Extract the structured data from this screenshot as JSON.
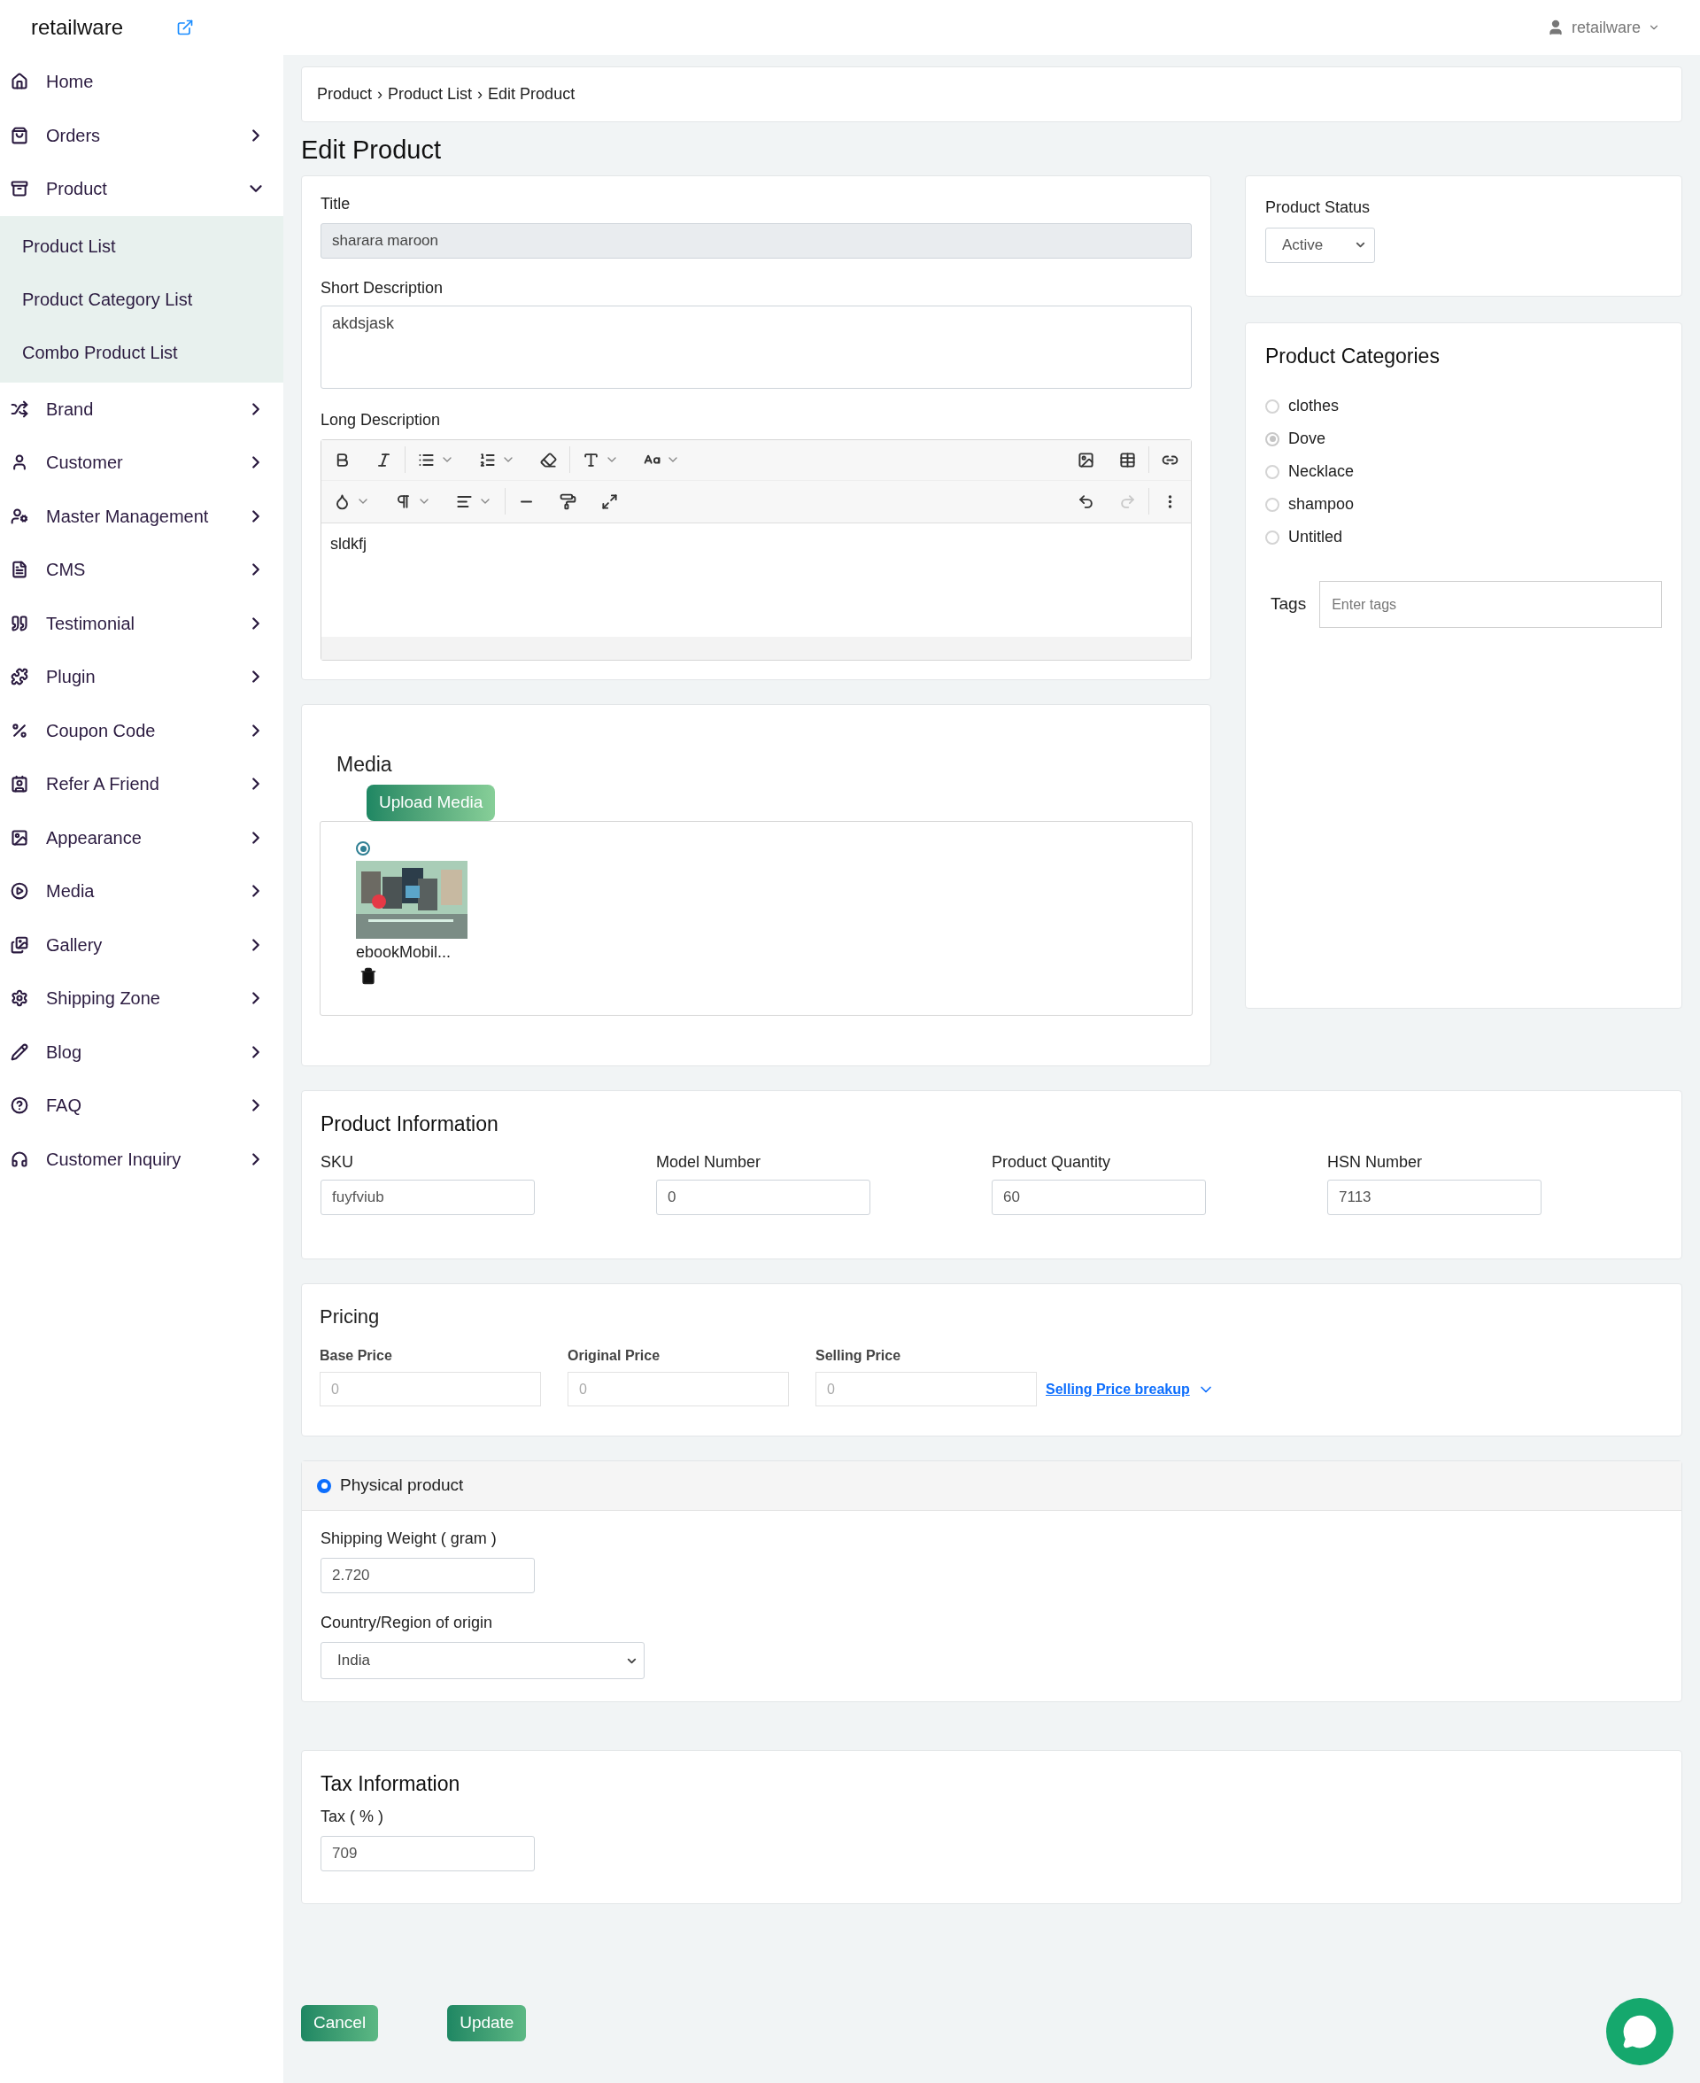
{
  "brand": {
    "name": "retailware"
  },
  "user_menu": {
    "label": "retailware"
  },
  "sidebar": {
    "items": [
      {
        "label": "Home",
        "kind": "link"
      },
      {
        "label": "Orders",
        "kind": "group",
        "expanded": false
      },
      {
        "label": "Product",
        "kind": "group",
        "expanded": true,
        "children": [
          {
            "label": "Product List"
          },
          {
            "label": "Product Category List"
          },
          {
            "label": "Combo Product List"
          }
        ]
      },
      {
        "label": "Brand",
        "kind": "group",
        "expanded": false
      },
      {
        "label": "Customer",
        "kind": "group",
        "expanded": false
      },
      {
        "label": "Master Management",
        "kind": "group",
        "expanded": false
      },
      {
        "label": "CMS",
        "kind": "group",
        "expanded": false
      },
      {
        "label": "Testimonial",
        "kind": "group",
        "expanded": false
      },
      {
        "label": "Plugin",
        "kind": "group",
        "expanded": false
      },
      {
        "label": "Coupon Code",
        "kind": "group",
        "expanded": false
      },
      {
        "label": "Refer A Friend",
        "kind": "group",
        "expanded": false
      },
      {
        "label": "Appearance",
        "kind": "group",
        "expanded": false
      },
      {
        "label": "Media",
        "kind": "group",
        "expanded": false
      },
      {
        "label": "Gallery",
        "kind": "group",
        "expanded": false
      },
      {
        "label": "Shipping Zone",
        "kind": "group",
        "expanded": false
      },
      {
        "label": "Blog",
        "kind": "group",
        "expanded": false
      },
      {
        "label": "FAQ",
        "kind": "group",
        "expanded": false
      },
      {
        "label": "Customer Inquiry",
        "kind": "group",
        "expanded": false
      }
    ]
  },
  "breadcrumb": [
    "Product",
    "Product List",
    "Edit Product"
  ],
  "breadcrumb_separator": "›",
  "page_title": "Edit Product",
  "general": {
    "title_label": "Title",
    "title_value": "sharara maroon",
    "short_description_label": "Short Description",
    "short_description_value": "akdsjask",
    "long_description_label": "Long Description",
    "editor": {
      "content": "sldkfj",
      "redo_disabled": true
    }
  },
  "status": {
    "label": "Product Status",
    "value": "Active"
  },
  "categories": {
    "title": "Product Categories",
    "items": [
      {
        "label": "clothes",
        "selected": false
      },
      {
        "label": "Dove",
        "selected": true
      },
      {
        "label": "Necklace",
        "selected": false
      },
      {
        "label": "shampoo",
        "selected": false
      },
      {
        "label": "Untitled",
        "selected": false
      }
    ],
    "tags_label": "Tags",
    "tags_placeholder": "Enter tags"
  },
  "media": {
    "title": "Media",
    "upload_button": "Upload Media",
    "files": [
      {
        "name": "ebookMobil...",
        "selected": true
      }
    ]
  },
  "product_information": {
    "title": "Product Information",
    "fields": [
      {
        "label": "SKU",
        "value": "fuyfviub"
      },
      {
        "label": "Model Number",
        "value": "0"
      },
      {
        "label": "Product Quantity",
        "value": "60"
      },
      {
        "label": "HSN Number",
        "value": "7113"
      }
    ]
  },
  "pricing": {
    "title": "Pricing",
    "fields": [
      {
        "label": "Base Price",
        "placeholder": "0"
      },
      {
        "label": "Original Price",
        "placeholder": "0"
      },
      {
        "label": "Selling Price",
        "placeholder": "0"
      }
    ],
    "breakup_link": "Selling Price breakup"
  },
  "shipping": {
    "type_label": "Physical product",
    "selected": true,
    "weight_label": "Shipping Weight ( gram )",
    "weight_value": "2.720",
    "country_label": "Country/Region of origin",
    "country_value": "India"
  },
  "tax": {
    "title": "Tax Information",
    "label": "Tax ( % )",
    "value": "709"
  },
  "buttons": [
    "Cancel",
    "Update"
  ]
}
